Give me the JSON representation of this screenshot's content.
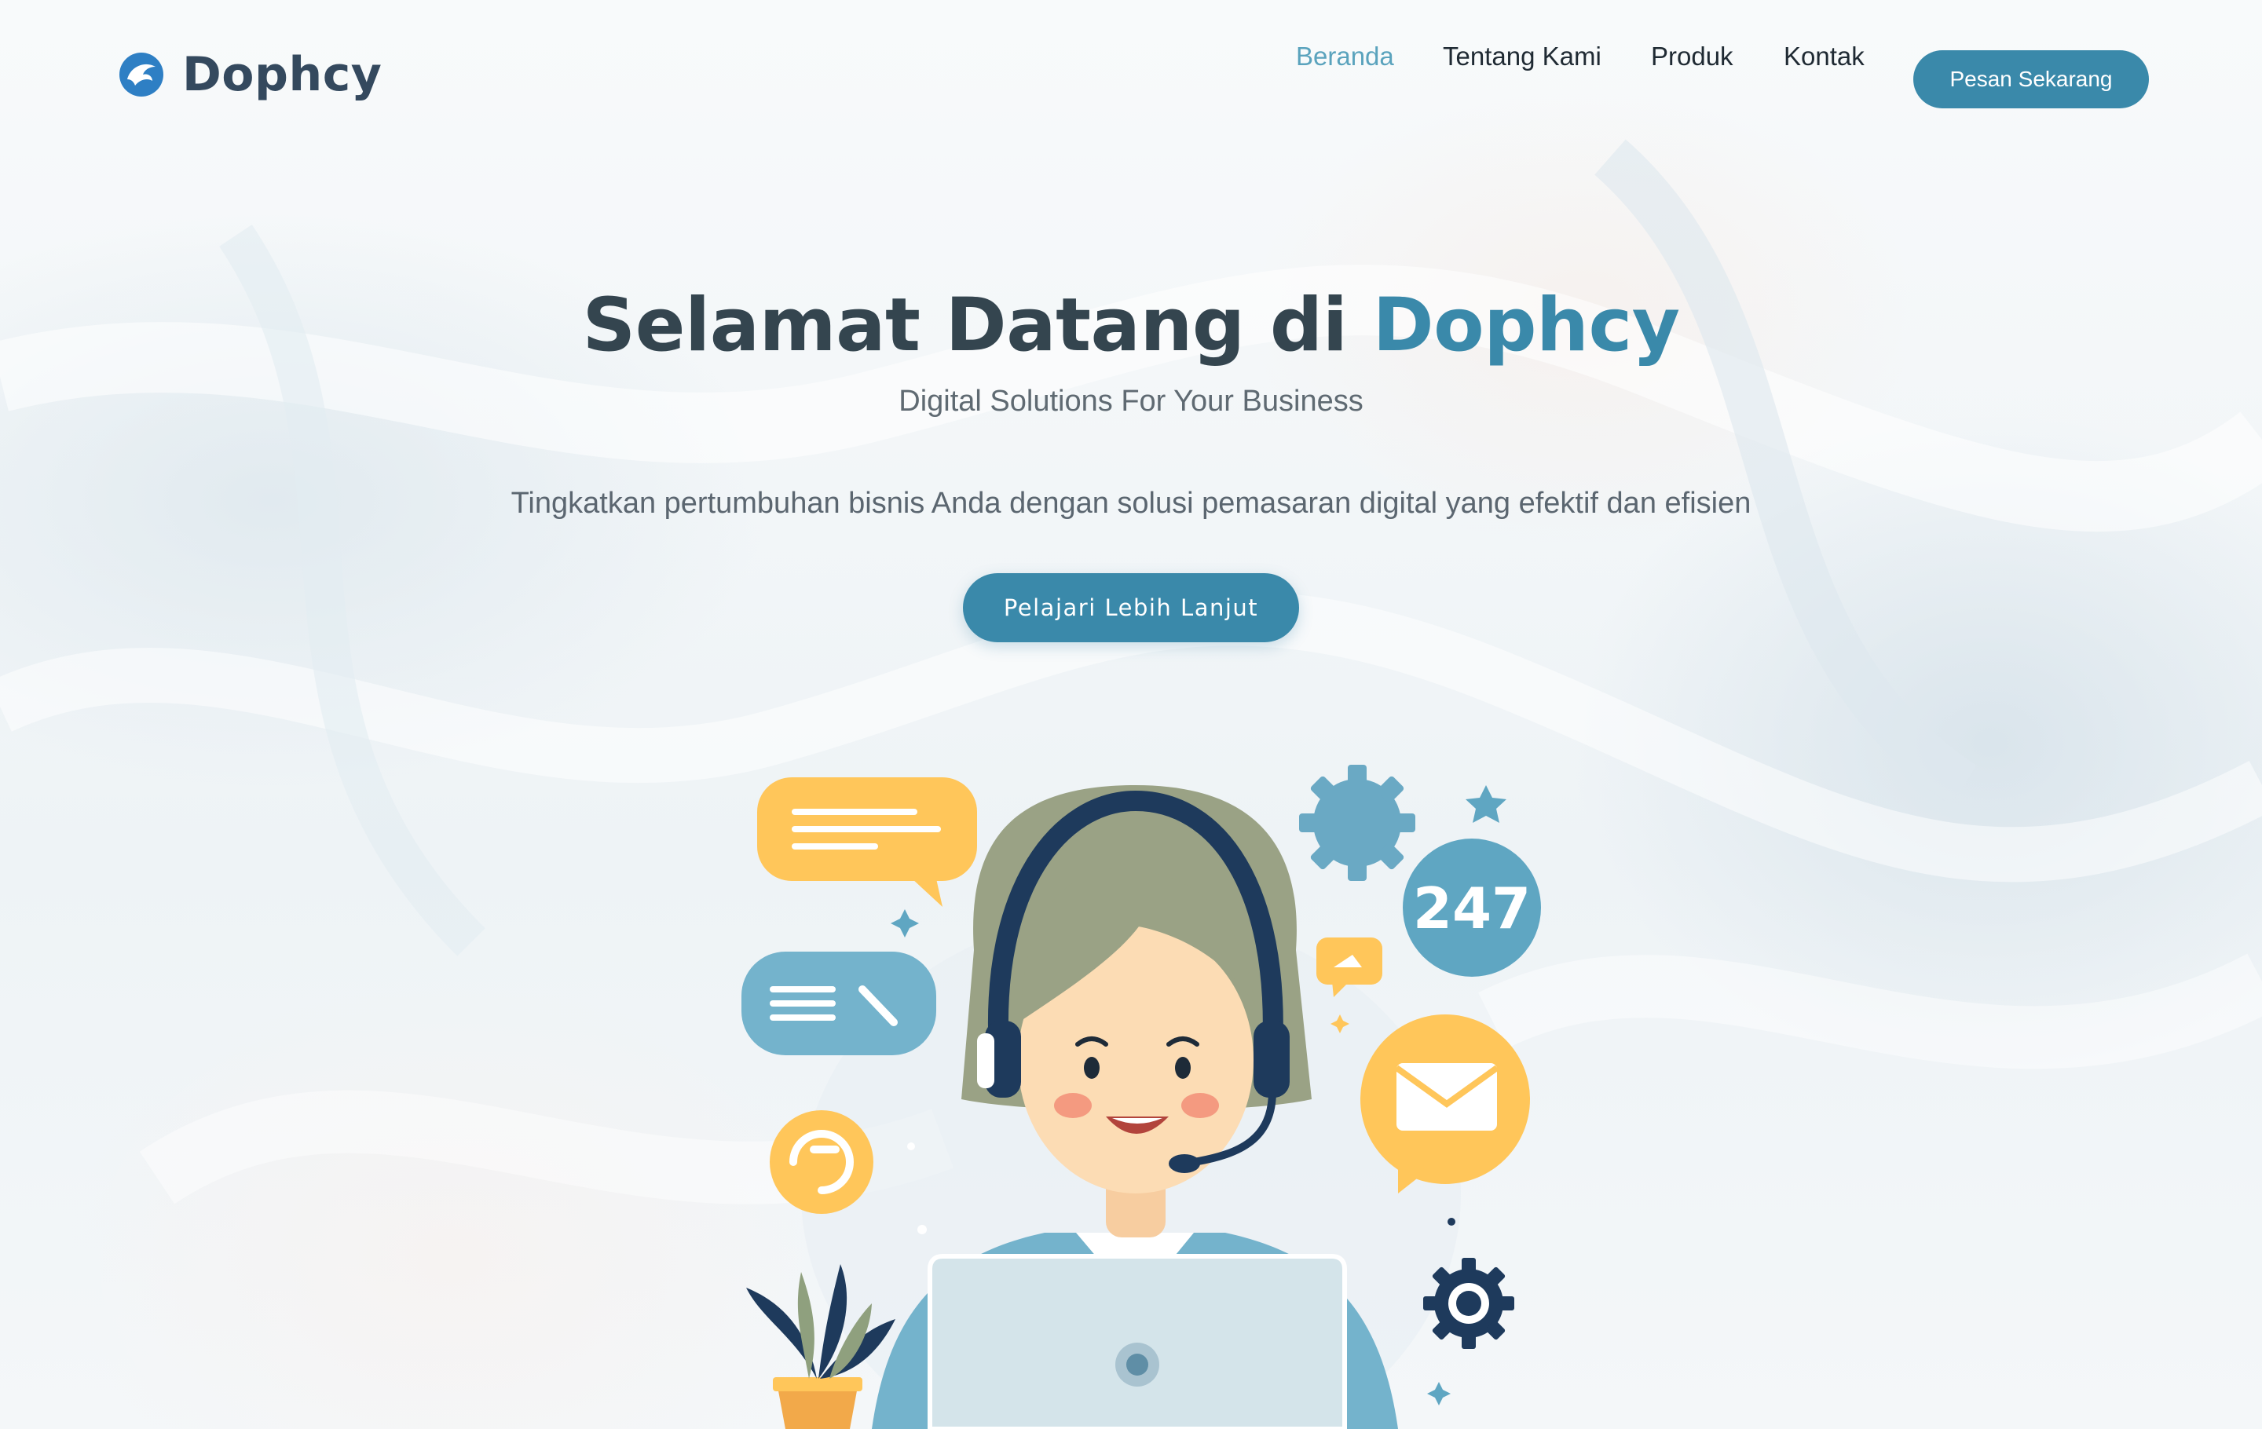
{
  "brand": {
    "name": "Dophcy"
  },
  "nav": {
    "items": [
      {
        "label": "Beranda",
        "active": true
      },
      {
        "label": "Tentang Kami",
        "active": false
      },
      {
        "label": "Produk",
        "active": false
      },
      {
        "label": "Kontak",
        "active": false
      }
    ],
    "cta_label": "Pesan Sekarang"
  },
  "hero": {
    "title_prefix": "Selamat Datang di ",
    "title_brand": "Dophcy",
    "subtitle": "Digital Solutions For Your Business",
    "lead": "Tingkatkan pertumbuhan bisnis Anda dengan solusi pemasaran digital yang efektif dan efisien",
    "cta_label": "Pelajari Lebih Lanjut"
  },
  "illustration": {
    "badge_text": "247"
  },
  "colors": {
    "accent": "#3a89aa",
    "accent_light": "#5aa3bd",
    "heading": "#34454f",
    "yellow": "#ffc65a",
    "navy": "#1e3a5c"
  }
}
